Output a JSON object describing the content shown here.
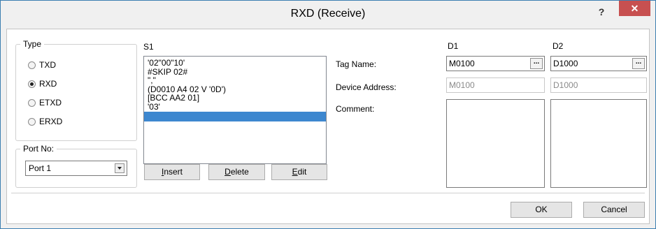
{
  "window": {
    "title": "RXD (Receive)",
    "help_label": "?",
    "close_label": "✕"
  },
  "type_group": {
    "legend": "Type",
    "options": [
      {
        "label": "TXD",
        "selected": false
      },
      {
        "label": "RXD",
        "selected": true
      },
      {
        "label": "ETXD",
        "selected": false
      },
      {
        "label": "ERXD",
        "selected": false
      }
    ]
  },
  "port_group": {
    "legend": "Port No:",
    "value": "Port 1"
  },
  "s1": {
    "label": "S1",
    "items": [
      "'02\"00\"10'",
      "#SKIP 02#",
      "\",\"",
      "(D0010 A4 02 V '0D')",
      "[BCC AA2 01]",
      "'03'",
      ""
    ],
    "selected_index": 6
  },
  "buttons": {
    "insert": {
      "label": "Insert",
      "mnemonic": "I",
      "rest": "nsert"
    },
    "delete": {
      "label": "Delete",
      "mnemonic": "D",
      "rest": "elete"
    },
    "edit": {
      "label": "Edit",
      "mnemonic": "E",
      "rest": "dit"
    },
    "ok": "OK",
    "cancel": "Cancel"
  },
  "fields": {
    "tag_name": "Tag Name:",
    "device_address": "Device Address:",
    "comment": "Comment:"
  },
  "d1": {
    "label": "D1",
    "tag_name": "M0100",
    "device_address": "M0100",
    "browse": "..."
  },
  "d2": {
    "label": "D2",
    "tag_name": "D1000",
    "device_address": "D1000",
    "browse": "..."
  }
}
